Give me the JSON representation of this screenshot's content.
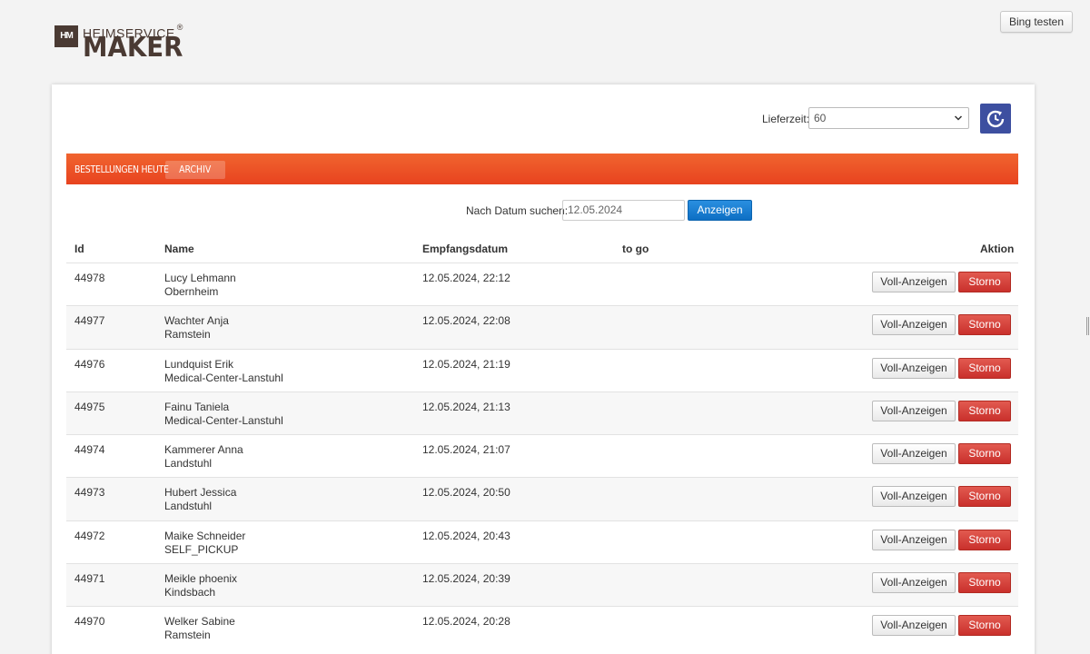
{
  "logo": {
    "mark": "HM",
    "line1": "HEIMSERVICE",
    "registered": "®",
    "line2": "MAKER"
  },
  "header": {
    "bing_label": "Bing testen"
  },
  "lieferzeit": {
    "label": "Lieferzeit:",
    "value": "60"
  },
  "tabs": {
    "heute": "BESTELLUNGEN HEUTE",
    "archiv": "ARCHIV"
  },
  "search": {
    "label": "Nach Datum suchen:",
    "value": "12.05.2024",
    "button": "Anzeigen"
  },
  "table": {
    "headers": {
      "id": "Id",
      "name": "Name",
      "date": "Empfangsdatum",
      "togo": "to go",
      "action": "Aktion"
    },
    "button_voll": "Voll-Anzeigen",
    "button_storno": "Storno",
    "rows": [
      {
        "id": "44978",
        "name": "Lucy Lehmann",
        "city": "Obernheim",
        "date": "12.05.2024, 22:12"
      },
      {
        "id": "44977",
        "name": "Wachter Anja",
        "city": "Ramstein",
        "date": "12.05.2024, 22:08"
      },
      {
        "id": "44976",
        "name": "Lundquist Erik",
        "city": "Medical-Center-Lanstuhl",
        "date": "12.05.2024, 21:19"
      },
      {
        "id": "44975",
        "name": "Fainu Taniela",
        "city": "Medical-Center-Lanstuhl",
        "date": "12.05.2024, 21:13"
      },
      {
        "id": "44974",
        "name": "Kammerer Anna",
        "city": "Landstuhl",
        "date": "12.05.2024, 21:07"
      },
      {
        "id": "44973",
        "name": "Hubert Jessica",
        "city": "Landstuhl",
        "date": "12.05.2024, 20:50"
      },
      {
        "id": "44972",
        "name": "Maike Schneider",
        "city": "SELF_PICKUP",
        "date": "12.05.2024, 20:43"
      },
      {
        "id": "44971",
        "name": "Meikle phoenix",
        "city": "Kindsbach",
        "date": "12.05.2024, 20:39"
      },
      {
        "id": "44970",
        "name": "Welker Sabine",
        "city": "Ramstein",
        "date": "12.05.2024, 20:28"
      }
    ]
  },
  "colors": {
    "accent": "#e8431f",
    "primary_button": "#0d6fc4",
    "danger": "#c9302c",
    "refresh_bg": "#3d4fa0"
  },
  "icons": {
    "refresh": "refresh-clock-icon",
    "select_chevron": "chevron-down-icon"
  }
}
